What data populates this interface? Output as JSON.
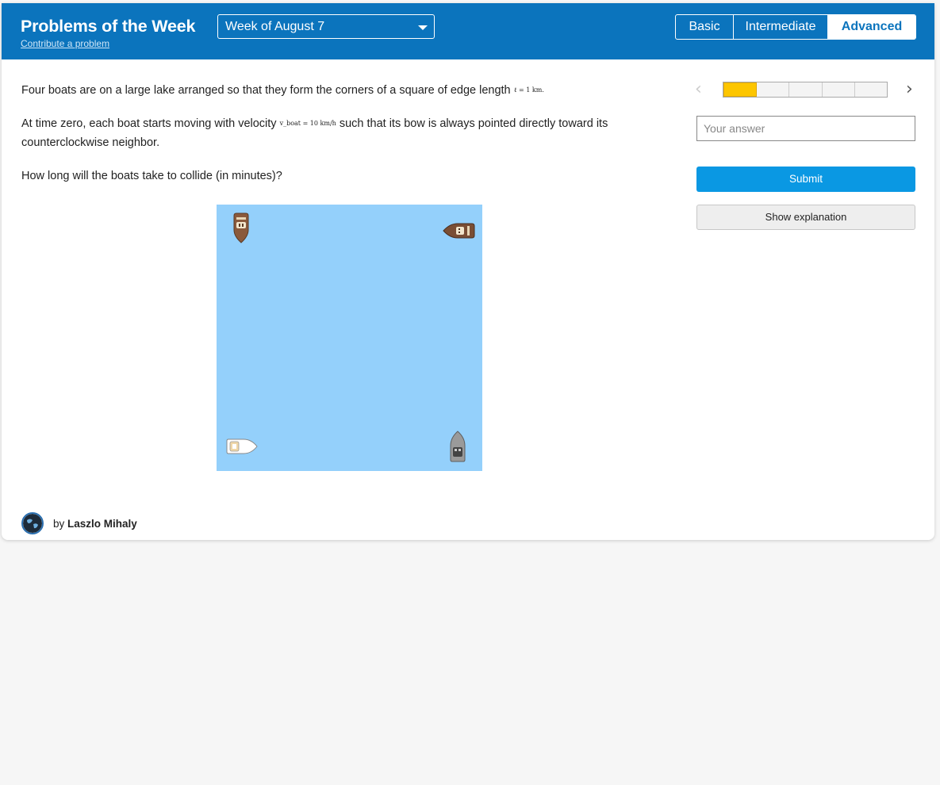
{
  "header": {
    "title": "Problems of the Week",
    "contribute": "Contribute a problem",
    "week": "Week of August 7",
    "levels": [
      "Basic",
      "Intermediate",
      "Advanced"
    ],
    "active_level": "Advanced"
  },
  "problem": {
    "p1": "Four boats are on a large lake arranged so that they form the corners of a square of edge length ",
    "p1_math": "ℓ = 1 km.",
    "p2_a": "At time zero, each boat starts moving with velocity ",
    "p2_math": "v_boat = 10 km/h",
    "p2_b": " such that its bow is always pointed directly toward its counterclockwise neighbor.",
    "p3": "How long will the boats take to collide (in minutes)?"
  },
  "sidebar": {
    "prev_icon": "chevron-left-icon",
    "next_icon": "chevron-right-icon",
    "progress_total": 5,
    "progress_current": 1,
    "answer_placeholder": "Your answer",
    "submit_label": "Submit",
    "explain_label": "Show explanation"
  },
  "author": {
    "prefix": "by",
    "name": "Laszlo Mihaly"
  },
  "colors": {
    "header": "#0b74bd",
    "lake": "#94d0fb",
    "submit": "#0a98e3",
    "progress_current": "#fdc600"
  }
}
